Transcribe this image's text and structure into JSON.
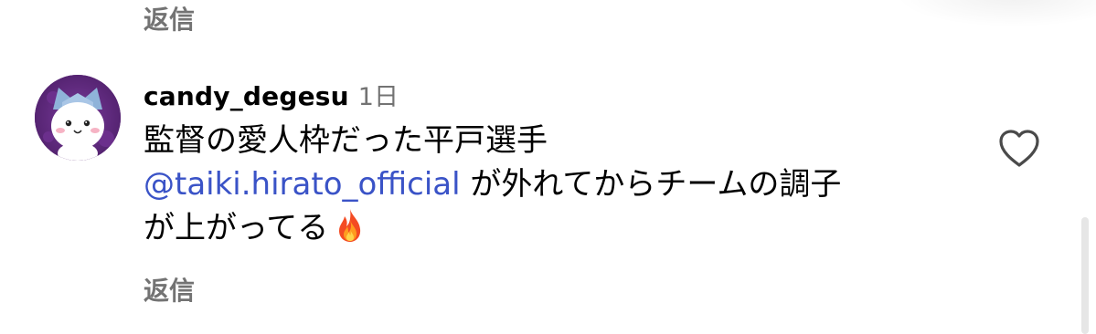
{
  "previous_reply": {
    "label": "返信"
  },
  "comment": {
    "username": "candy_degesu",
    "time": "1日",
    "text_line1": "監督の愛人枠だった平戸選手",
    "mention": "@taiki.hirato_official",
    "text_after_mention": " が外れてからチームの調子",
    "text_line3": "が上がってる",
    "emoji": "fire-emoji",
    "reply_label": "返信"
  },
  "icons": {
    "like": "heart-outline-icon",
    "avatar": "avatar-cat-character"
  },
  "colors": {
    "mention": "#3a53c7",
    "muted": "#737373",
    "avatar_bg": "#5b2a7a"
  }
}
